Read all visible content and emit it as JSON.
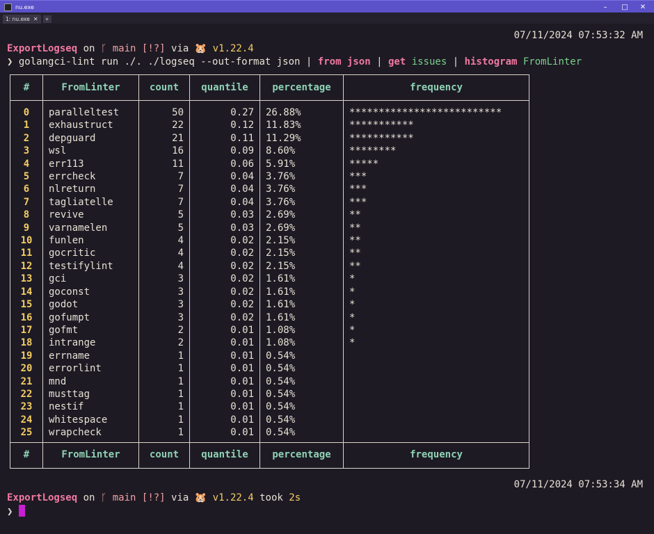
{
  "window": {
    "title": "nu.exe"
  },
  "tabs": [
    {
      "label": "1: nu.exe"
    }
  ],
  "prompt1": {
    "timestamp": "07/11/2024 07:53:32 AM",
    "dir": "ExportLogseq",
    "on": "on",
    "branch_icon": "ᚴ",
    "branch": "main",
    "status": "[!?]",
    "via": "via",
    "lang_icon": "🐹",
    "version": "v1.22.4"
  },
  "command": {
    "chev": "❯",
    "tool": "golangci-lint",
    "args": "run ./. ./logseq --out-format json",
    "pipe1": "|",
    "from": "from json",
    "pipe2": "|",
    "get": "get",
    "get_arg": "issues",
    "pipe3": "|",
    "hist": "histogram",
    "hist_arg": "FromLinter"
  },
  "table": {
    "headers": [
      "#",
      "FromLinter",
      "count",
      "quantile",
      "percentage",
      "frequency"
    ],
    "rows": [
      [
        "0",
        "paralleltest",
        "50",
        "0.27",
        "26.88%",
        "**************************"
      ],
      [
        "1",
        "exhaustruct",
        "22",
        "0.12",
        "11.83%",
        "***********"
      ],
      [
        "2",
        "depguard",
        "21",
        "0.11",
        "11.29%",
        "***********"
      ],
      [
        "3",
        "wsl",
        "16",
        "0.09",
        "8.60%",
        "********"
      ],
      [
        "4",
        "err113",
        "11",
        "0.06",
        "5.91%",
        "*****"
      ],
      [
        "5",
        "errcheck",
        "7",
        "0.04",
        "3.76%",
        "***"
      ],
      [
        "6",
        "nlreturn",
        "7",
        "0.04",
        "3.76%",
        "***"
      ],
      [
        "7",
        "tagliatelle",
        "7",
        "0.04",
        "3.76%",
        "***"
      ],
      [
        "8",
        "revive",
        "5",
        "0.03",
        "2.69%",
        "**"
      ],
      [
        "9",
        "varnamelen",
        "5",
        "0.03",
        "2.69%",
        "**"
      ],
      [
        "10",
        "funlen",
        "4",
        "0.02",
        "2.15%",
        "**"
      ],
      [
        "11",
        "gocritic",
        "4",
        "0.02",
        "2.15%",
        "**"
      ],
      [
        "12",
        "testifylint",
        "4",
        "0.02",
        "2.15%",
        "**"
      ],
      [
        "13",
        "gci",
        "3",
        "0.02",
        "1.61%",
        "*"
      ],
      [
        "14",
        "goconst",
        "3",
        "0.02",
        "1.61%",
        "*"
      ],
      [
        "15",
        "godot",
        "3",
        "0.02",
        "1.61%",
        "*"
      ],
      [
        "16",
        "gofumpt",
        "3",
        "0.02",
        "1.61%",
        "*"
      ],
      [
        "17",
        "gofmt",
        "2",
        "0.01",
        "1.08%",
        "*"
      ],
      [
        "18",
        "intrange",
        "2",
        "0.01",
        "1.08%",
        "*"
      ],
      [
        "19",
        "errname",
        "1",
        "0.01",
        "0.54%",
        ""
      ],
      [
        "20",
        "errorlint",
        "1",
        "0.01",
        "0.54%",
        ""
      ],
      [
        "21",
        "mnd",
        "1",
        "0.01",
        "0.54%",
        ""
      ],
      [
        "22",
        "musttag",
        "1",
        "0.01",
        "0.54%",
        ""
      ],
      [
        "23",
        "nestif",
        "1",
        "0.01",
        "0.54%",
        ""
      ],
      [
        "24",
        "whitespace",
        "1",
        "0.01",
        "0.54%",
        ""
      ],
      [
        "25",
        "wrapcheck",
        "1",
        "0.01",
        "0.54%",
        ""
      ]
    ]
  },
  "prompt2": {
    "timestamp": "07/11/2024 07:53:34 AM",
    "dir": "ExportLogseq",
    "on": "on",
    "branch_icon": "ᚴ",
    "branch": "main",
    "status": "[!?]",
    "via": "via",
    "lang_icon": "🐹",
    "version": "v1.22.4",
    "took": "took",
    "duration": "2s",
    "chev": "❯"
  },
  "colors": {
    "background": "#1d1a24",
    "titlebar": "#5b51c9",
    "header": "#8fd2b4",
    "index": "#f4cd63",
    "cursor": "#c81fd3"
  }
}
